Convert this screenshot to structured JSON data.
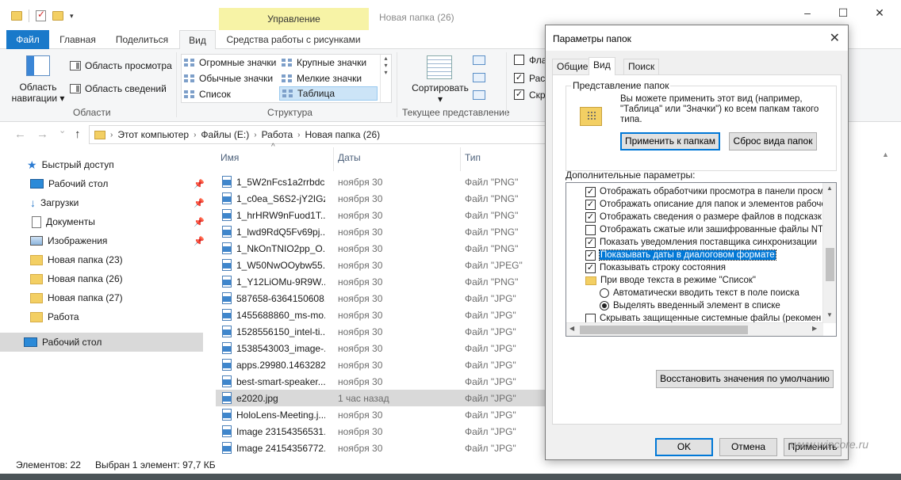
{
  "titlebar": {
    "context_tab": "Управление",
    "window_title": "Новая папка (26)",
    "minimize": "–",
    "maximize": "☐",
    "close": "✕"
  },
  "ribbon_tabs": {
    "file": "Файл",
    "home": "Главная",
    "share": "Поделиться",
    "view": "Вид",
    "picture_tools": "Средства работы с рисунками"
  },
  "ribbon": {
    "nav_pane": "Область навигации",
    "nav_pane_arrow": "▾",
    "preview_pane": "Область просмотра",
    "details_pane": "Область сведений",
    "panes_group": "Области",
    "layout": {
      "extra_large": "Огромные значки",
      "large": "Крупные значки",
      "medium": "Обычные значки",
      "small": "Мелкие значки",
      "list": "Список",
      "details": "Таблица"
    },
    "layout_group": "Структура",
    "sort": "Сортировать",
    "sort_arrow": "▾",
    "current_view_group": "Текущее представление",
    "chk1": "Флаж",
    "chk2": "Расш",
    "chk3": "Скр"
  },
  "address": {
    "back": "←",
    "forward": "→",
    "recent": "⌄",
    "up": "↑",
    "crumbs": [
      "Этот компьютер",
      "Файлы (E:)",
      "Работа",
      "Новая папка (26)"
    ],
    "separator": "›"
  },
  "nav": {
    "quick_access": "Быстрый доступ",
    "desktop": "Рабочий стол",
    "downloads": "Загрузки",
    "documents": "Документы",
    "pictures": "Изображения",
    "folder23": "Новая папка (23)",
    "folder26": "Новая папка (26)",
    "folder27": "Новая папка (27)",
    "work": "Работа",
    "desktop_root": "Рабочий стол"
  },
  "columns": {
    "name": "Имя",
    "date": "Даты",
    "type": "Тип"
  },
  "files": [
    {
      "name": "1_5W2nFcs1a2rrbdc...",
      "date": "ноября 30",
      "type": "Файл \"PNG\""
    },
    {
      "name": "1_c0ea_S6S2-jY2IGzl...",
      "date": "ноября 30",
      "type": "Файл \"PNG\""
    },
    {
      "name": "1_hrHRW9nFuod1T...",
      "date": "ноября 30",
      "type": "Файл \"PNG\""
    },
    {
      "name": "1_lwd9RdQ5Fv69pj...",
      "date": "ноября 30",
      "type": "Файл \"PNG\""
    },
    {
      "name": "1_NkOnTNIO2pp_O...",
      "date": "ноября 30",
      "type": "Файл \"PNG\""
    },
    {
      "name": "1_W50NwOOybw55...",
      "date": "ноября 30",
      "type": "Файл \"JPEG\""
    },
    {
      "name": "1_Y12LiOMu-9R9W...",
      "date": "ноября 30",
      "type": "Файл \"PNG\""
    },
    {
      "name": "587658-6364150608...",
      "date": "ноября 30",
      "type": "Файл \"JPG\""
    },
    {
      "name": "1455688860_ms-mo...",
      "date": "ноября 30",
      "type": "Файл \"JPG\""
    },
    {
      "name": "1528556150_intel-ti...",
      "date": "ноября 30",
      "type": "Файл \"JPG\""
    },
    {
      "name": "1538543003_image-...",
      "date": "ноября 30",
      "type": "Файл \"JPG\""
    },
    {
      "name": "apps.29980.1463282...",
      "date": "ноября 30",
      "type": "Файл \"JPG\""
    },
    {
      "name": "best-smart-speaker...",
      "date": "ноября 30",
      "type": "Файл \"JPG\""
    },
    {
      "name": "e2020.jpg",
      "date": "1 час назад",
      "type": "Файл \"JPG\""
    },
    {
      "name": "HoloLens-Meeting.j...",
      "date": "ноября 30",
      "type": "Файл \"JPG\""
    },
    {
      "name": "Image 23154356531...",
      "date": "ноября 30",
      "type": "Файл \"JPG\""
    },
    {
      "name": "Image 24154356772...",
      "date": "ноября 30",
      "type": "Файл \"JPG\""
    }
  ],
  "status": {
    "count": "Элементов: 22",
    "selected": "Выбран 1 элемент: 97,7 КБ"
  },
  "dialog": {
    "title": "Параметры папок",
    "close": "✕",
    "tabs": {
      "general": "Общие",
      "view": "Вид",
      "search": "Поиск"
    },
    "folder_views_legend": "Представление папок",
    "folder_views_text": "Вы можете применить этот вид (например, \"Таблица\" или \"Значки\") ко всем папкам такого типа.",
    "apply_to_folders": "Применить к папкам",
    "reset_folders": "Сброс вида папок",
    "advanced_label": "Дополнительные параметры:",
    "tree": [
      {
        "kind": "check",
        "checked": "✓",
        "label": "Отображать обработчики просмотра в панели просм"
      },
      {
        "kind": "check",
        "checked": "✓",
        "label": "Отображать описание для папок и элементов рабоче"
      },
      {
        "kind": "check",
        "checked": "✓",
        "label": "Отображать сведения о размере файлов в подсказк"
      },
      {
        "kind": "check",
        "checked": "",
        "label": "Отображать сжатые или зашифрованные файлы NTI"
      },
      {
        "kind": "check",
        "checked": "✓",
        "label": "Показать уведомления поставщика синхронизации"
      },
      {
        "kind": "check",
        "checked": "✓",
        "label": "Показывать даты в диалоговом формате"
      },
      {
        "kind": "check",
        "checked": "✓",
        "label": "Показывать строку состояния"
      },
      {
        "kind": "folder",
        "checked": "",
        "label": "При вводе текста в режиме \"Список\""
      },
      {
        "kind": "radio",
        "checked": "",
        "label": "Автоматически вводить текст в поле поиска"
      },
      {
        "kind": "radio",
        "checked": "on",
        "label": "Выделять введенный элемент в списке"
      },
      {
        "kind": "check",
        "checked": "",
        "label": "Скрывать защищенные системные файлы (рекомен"
      }
    ],
    "restore_defaults": "Восстановить значения по умолчанию",
    "ok": "OK",
    "cancel": "Отмена",
    "apply": "Применить"
  },
  "watermark": "www.wincore.ru"
}
